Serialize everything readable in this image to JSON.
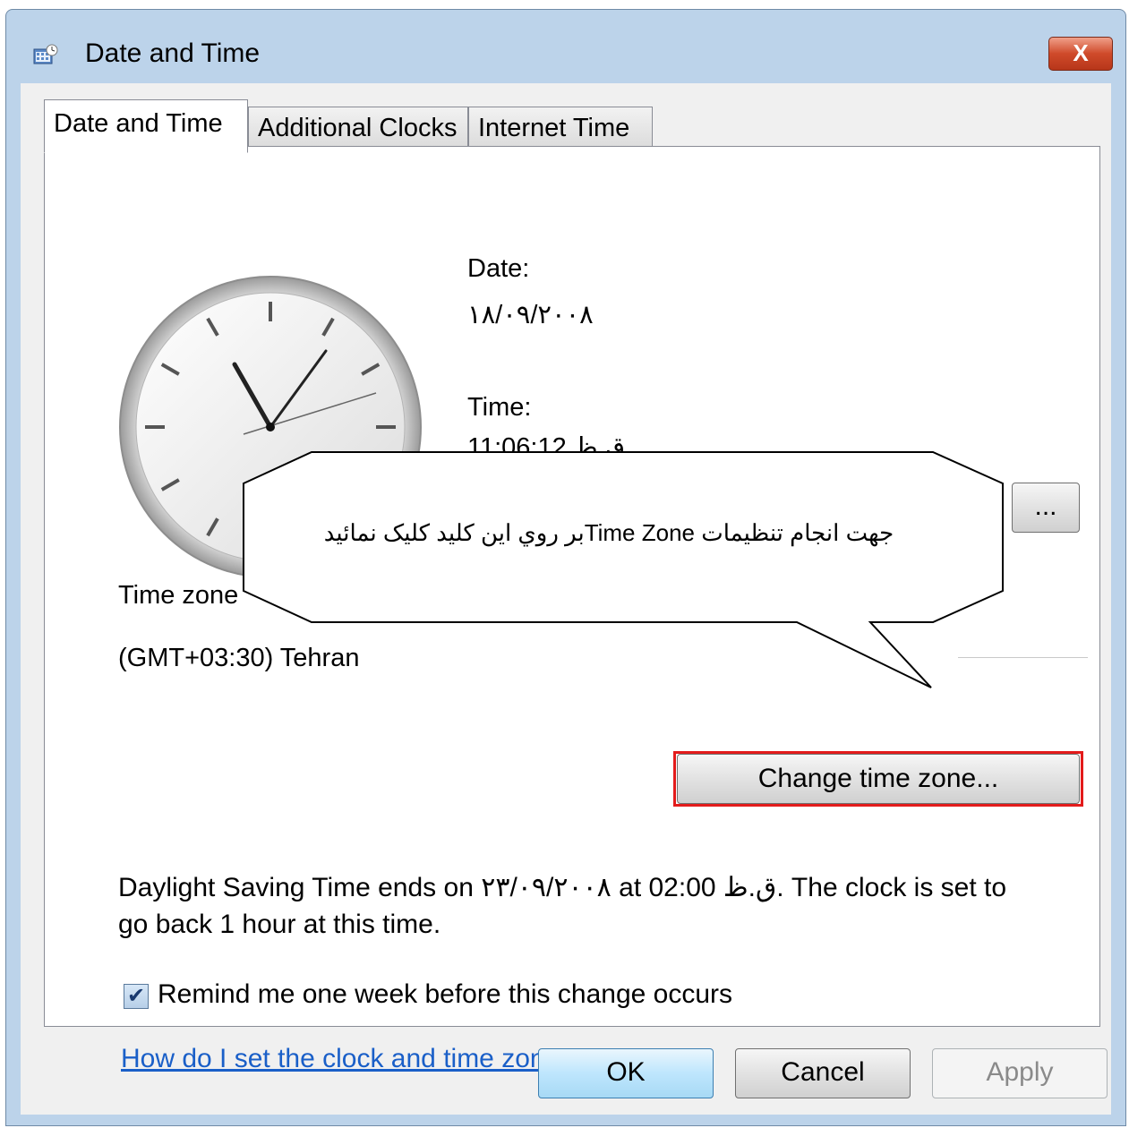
{
  "window": {
    "title": "Date and Time",
    "close_glyph": "X"
  },
  "tabs": [
    {
      "label": "Date and Time"
    },
    {
      "label": "Additional Clocks"
    },
    {
      "label": "Internet Time"
    }
  ],
  "date": {
    "label": "Date:",
    "value": "۱۸/۰۹/۲۰۰۸"
  },
  "time": {
    "label": "Time:",
    "value": "11:06:12 ق.ظ"
  },
  "change_date_button": {
    "label": "..."
  },
  "timezone": {
    "label": "Time zone",
    "value": "(GMT+03:30) Tehran",
    "change_button": "Change time zone..."
  },
  "dst": {
    "line1": "Daylight Saving Time ends on ۲۳/۰۹/۲۰۰۸ at 02:00 ق.ظ. The clock is set to",
    "line2": "go back 1 hour at this time."
  },
  "remind": {
    "checked": true,
    "label": "Remind me one week before this change occurs"
  },
  "help_link": "How do I set the clock and time zone?",
  "footer": {
    "ok": "OK",
    "cancel": "Cancel",
    "apply": "Apply"
  },
  "callout": {
    "text": "جهت انجام تنظیمات Time Zoneبر روي اين كليد كليک نمائيد"
  },
  "colors": {
    "highlight": "#e31b1b",
    "link": "#1a5fc8",
    "window_frame": "#bcd3ea"
  }
}
